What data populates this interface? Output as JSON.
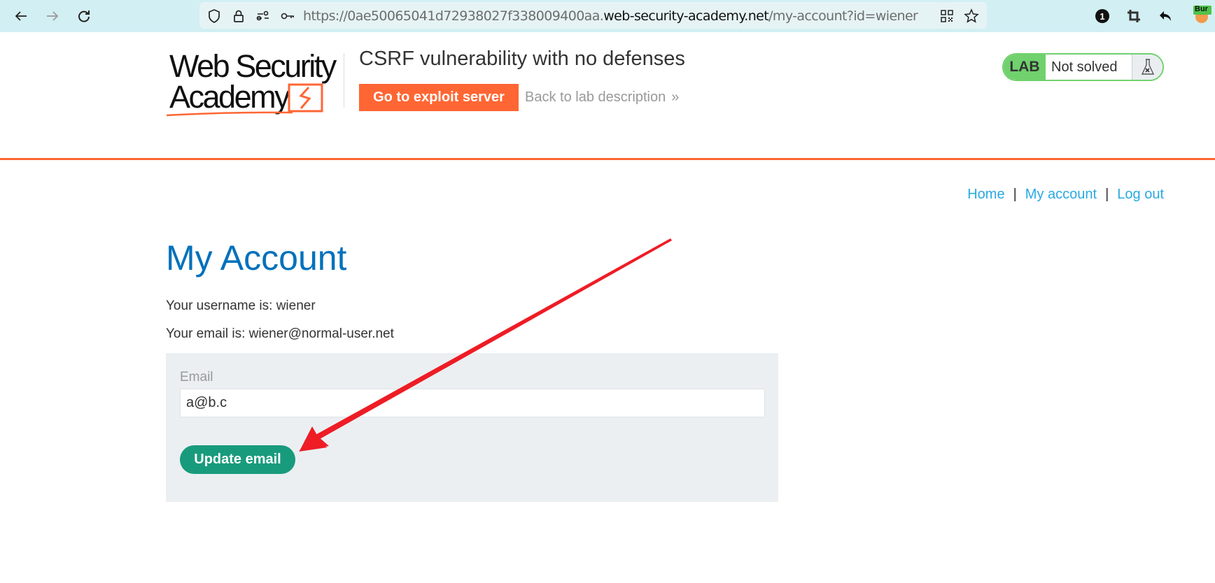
{
  "browser": {
    "url_prefix": "https://0ae50065041d72938027f338009400aa.",
    "url_host": "web-security-academy.net",
    "url_path": "/my-account?id=wiener",
    "notification_count": "1",
    "extension_badge": "Bur"
  },
  "header": {
    "logo_line1": "Web Security",
    "logo_line2": "Academy",
    "lab_title": "CSRF vulnerability with no defenses",
    "exploit_button": "Go to exploit server",
    "back_link": "Back to lab description",
    "back_chevron": "»",
    "lab_badge": "LAB",
    "lab_status": "Not solved"
  },
  "nav": {
    "links": [
      "Home",
      "My account",
      "Log out"
    ],
    "separator": "|"
  },
  "main": {
    "heading": "My Account",
    "username_line": "Your username is: wiener",
    "email_line": "Your email is: wiener@normal-user.net",
    "form": {
      "email_label": "Email",
      "email_value": "a@b.c",
      "submit_label": "Update email"
    }
  },
  "colors": {
    "accent_orange": "#ff6633",
    "heading_blue": "#0071bc",
    "link_blue": "#29a9e1",
    "button_green": "#189b7c",
    "lab_green": "#70d16d",
    "annotation_red": "#ee1c25"
  }
}
